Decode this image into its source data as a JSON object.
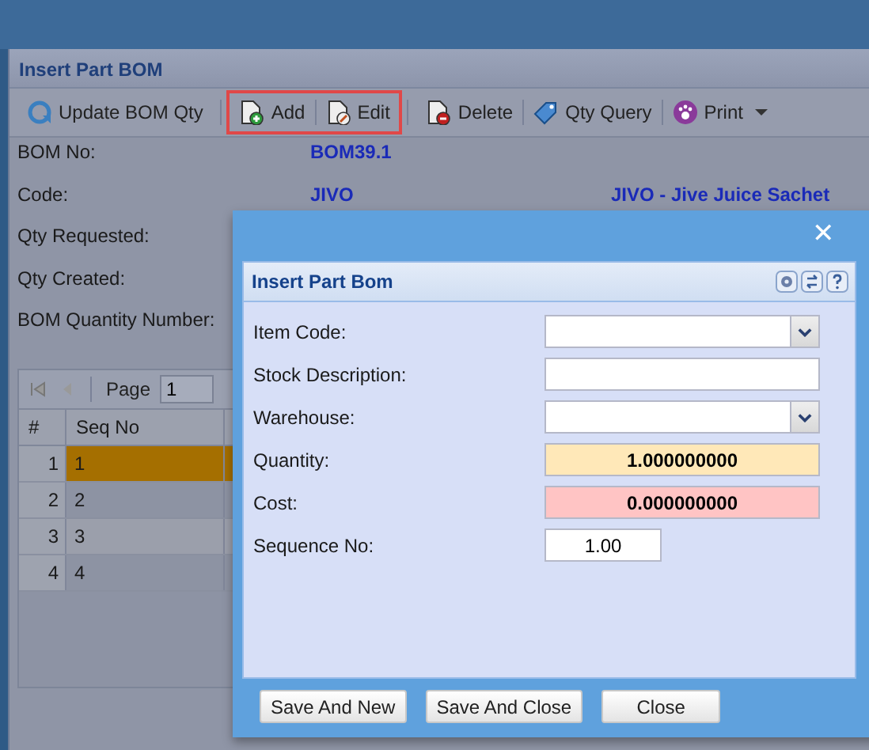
{
  "panel": {
    "title": "Insert Part BOM"
  },
  "toolbar": [
    {
      "highlighted": false,
      "buttons": [
        {
          "label": "Update BOM Qty",
          "kind": "refresh",
          "has_menu": false
        }
      ]
    },
    {
      "highlighted": true,
      "buttons": [
        {
          "label": "Add",
          "kind": "add",
          "has_menu": false
        },
        {
          "label": "Edit",
          "kind": "edit",
          "has_menu": false
        }
      ]
    },
    {
      "highlighted": false,
      "buttons": [
        {
          "label": "Delete",
          "kind": "delete",
          "has_menu": false
        },
        {
          "label": "Qty Query",
          "kind": "tag",
          "has_menu": false
        },
        {
          "label": "Print",
          "kind": "paw",
          "has_menu": true
        }
      ]
    }
  ],
  "details": [
    {
      "label": "BOM No:",
      "value": "BOM39.1"
    },
    {
      "label": "Code:",
      "value": "JIVO",
      "description": "JIVO - Jive Juice Sachet"
    },
    {
      "label": "Qty Requested:"
    },
    {
      "label": "Qty Created:"
    },
    {
      "label": "BOM Quantity Number:"
    }
  ],
  "grid": {
    "pager": {
      "label": "Page",
      "page": "1"
    },
    "columns": [
      "#",
      "Seq No"
    ],
    "rows": [
      {
        "index": "1",
        "seq_no": "1",
        "selected": true
      },
      {
        "index": "2",
        "seq_no": "2",
        "selected": false
      },
      {
        "index": "3",
        "seq_no": "3",
        "selected": false
      },
      {
        "index": "4",
        "seq_no": "4",
        "selected": false
      }
    ]
  },
  "dialog": {
    "close": "✕",
    "panel_title": "Insert Part Bom",
    "fields": [
      {
        "label": "Item Code:",
        "kind": "combo"
      },
      {
        "label": "Stock Description:",
        "kind": "text"
      },
      {
        "label": "Warehouse:",
        "kind": "combo"
      },
      {
        "label": "Quantity:",
        "kind": "number",
        "value": "1.000000000",
        "color": "#ffe8b8"
      },
      {
        "label": "Cost:",
        "kind": "number",
        "value": "0.000000000",
        "color": "#ffc4c4"
      },
      {
        "label": "Sequence No:",
        "kind": "short",
        "value": "1.00"
      }
    ],
    "buttons": [
      "Save And New",
      "Save And Close",
      "Close"
    ]
  }
}
